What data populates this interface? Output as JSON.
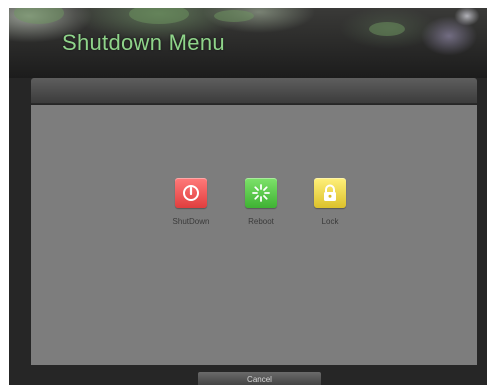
{
  "window": {
    "title": "Shutdown Menu"
  },
  "actions": [
    {
      "label": "ShutDown",
      "icon": "power-icon",
      "color": "#e84a4a"
    },
    {
      "label": "Reboot",
      "icon": "reboot-icon",
      "color": "#4cbf3c"
    },
    {
      "label": "Lock",
      "icon": "lock-icon",
      "color": "#e8d23a"
    }
  ],
  "footer": {
    "cancel_label": "Cancel"
  },
  "colors": {
    "title": "#8fd48a",
    "panel": "#7d7d7d",
    "background": "#262626"
  }
}
